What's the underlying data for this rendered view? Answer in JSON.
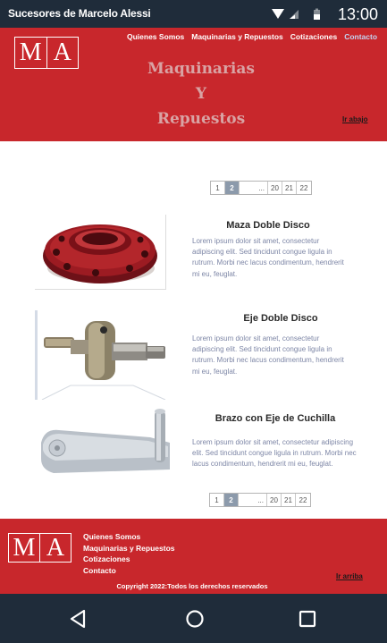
{
  "status_bar": {
    "title": "Sucesores de Marcelo Alessi",
    "time": "13:00",
    "icons": [
      "wifi-icon",
      "signal-icon",
      "battery-icon"
    ]
  },
  "header": {
    "logo": [
      "M",
      "A"
    ],
    "nav": [
      {
        "label": "Quienes Somos",
        "active": false
      },
      {
        "label": "Maquinarias y Repuestos",
        "active": false
      },
      {
        "label": "Cotizaciones",
        "active": false
      },
      {
        "label": "Contacto",
        "active": true
      }
    ],
    "title_lines": [
      "Maquinarias",
      "Y",
      "Repuestos"
    ],
    "jump_link": "Ir abajo"
  },
  "pagination": {
    "pages": [
      "1",
      "2",
      "...",
      "20",
      "21",
      "22"
    ],
    "active": "2"
  },
  "products": [
    {
      "name": "Maza Doble Disco",
      "description": "Lorem ipsum dolor  sit amet, consectetur adipiscing elit. Sed tincidunt congue ligula in rutrum. Morbi nec lacus condimentum, hendrerit mi eu, feuglat."
    },
    {
      "name": "Eje Doble Disco",
      "description": "Lorem ipsum dolor sit amet, consectetur adipiscing elit. Sed tincidunt congue ligula in rutrum. Morbi nec lacus condimentum, hendrerit mi eu, feuglat."
    },
    {
      "name": "Brazo con Eje de Cuchilla",
      "description": "Lorem ipsum dolor sit amet, consectetur adipiscing elit. Sed tincidunt congue ligula in rutrum. Morbi nec lacus condimentum, hendrerit mi eu, feuglat."
    }
  ],
  "footer": {
    "logo": [
      "M",
      "A"
    ],
    "links": [
      "Quienes Somos",
      "Maquinarias y Repuestos",
      "Cotizaciones",
      "Contacto"
    ],
    "jump_link": "Ir arriba",
    "copyright": "Copyright 2022:Todos los derechos reservados"
  },
  "nav_bar": {
    "icons": [
      "back-icon",
      "home-icon",
      "recent-apps-icon"
    ]
  },
  "colors": {
    "brand_red": "#c8272c",
    "system_bar": "#1f2c3a",
    "active_nav": "#c3d4f2",
    "active_page": "#8c9aab",
    "description_text": "#7d86a6"
  }
}
